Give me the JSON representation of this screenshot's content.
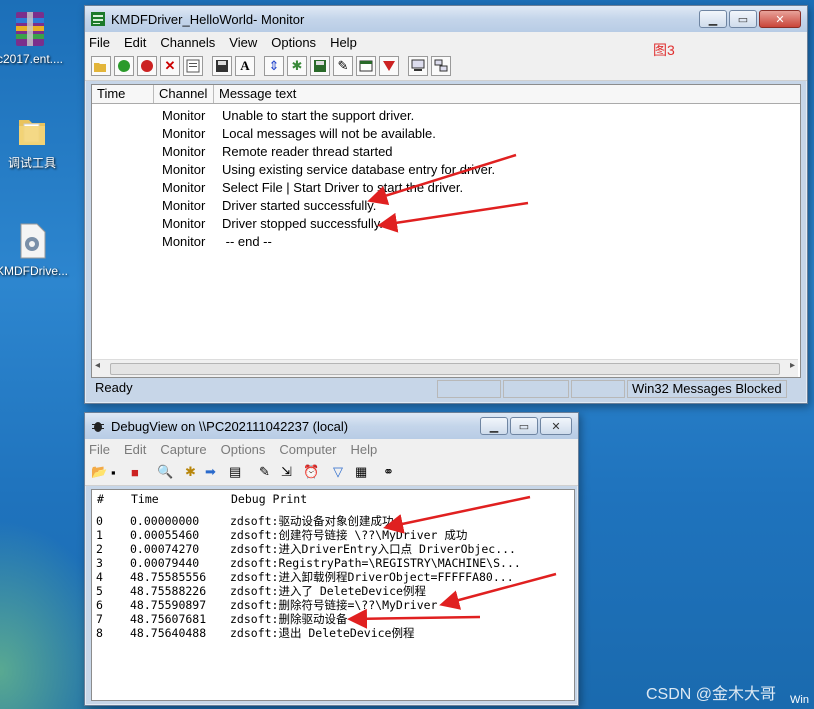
{
  "desktop": {
    "icons": [
      {
        "label": "c2017.ent...."
      },
      {
        "label": "调试工具"
      },
      {
        "label": "KMDFDrive..."
      }
    ],
    "watermark": "CSDN @金木大哥",
    "corner_text": "Win"
  },
  "monitor": {
    "title": "KMDFDriver_HelloWorld- Monitor",
    "menu": [
      "File",
      "Edit",
      "Channels",
      "View",
      "Options",
      "Help"
    ],
    "annotation": "图3",
    "columns": [
      "Time",
      "Channel",
      "Message text"
    ],
    "rows": [
      {
        "time": "",
        "channel": "Monitor",
        "message": "Unable to start the support driver."
      },
      {
        "time": "",
        "channel": "Monitor",
        "message": "Local messages will not be available."
      },
      {
        "time": "",
        "channel": "Monitor",
        "message": "Remote reader thread started"
      },
      {
        "time": "",
        "channel": "Monitor",
        "message": "Using existing service database entry for driver."
      },
      {
        "time": "",
        "channel": "Monitor",
        "message": "Select File | Start Driver to start the driver."
      },
      {
        "time": "",
        "channel": "Monitor",
        "message": "Driver started successfully."
      },
      {
        "time": "",
        "channel": "Monitor",
        "message": "Driver stopped successfully."
      },
      {
        "time": "",
        "channel": "Monitor",
        "message": " -- end --"
      }
    ],
    "status": {
      "ready": "Ready",
      "blocked": "Win32 Messages Blocked"
    }
  },
  "debugview": {
    "title": "DebugView on \\\\PC202111042237 (local)",
    "menu": [
      "File",
      "Edit",
      "Capture",
      "Options",
      "Computer",
      "Help"
    ],
    "columns": [
      "#",
      "Time",
      "Debug Print"
    ],
    "rows": [
      {
        "n": "0",
        "time": "0.00000000",
        "text": "zdsoft:驱动设备对象创建成功"
      },
      {
        "n": "1",
        "time": "0.00055460",
        "text": "zdsoft:创建符号链接 \\??\\MyDriver 成功"
      },
      {
        "n": "2",
        "time": "0.00074270",
        "text": "zdsoft:进入DriverEntry入口点 DriverObjec..."
      },
      {
        "n": "3",
        "time": "0.00079440",
        "text": "zdsoft:RegistryPath=\\REGISTRY\\MACHINE\\S..."
      },
      {
        "n": "4",
        "time": "48.75585556",
        "text": "zdsoft:进入卸载例程DriverObject=FFFFFA80..."
      },
      {
        "n": "5",
        "time": "48.75588226",
        "text": "zdsoft:进入了 DeleteDevice例程"
      },
      {
        "n": "6",
        "time": "48.75590897",
        "text": "zdsoft:删除符号链接=\\??\\MyDriver"
      },
      {
        "n": "7",
        "time": "48.75607681",
        "text": "zdsoft:删除驱动设备"
      },
      {
        "n": "8",
        "time": "48.75640488",
        "text": "zdsoft:退出 DeleteDevice例程"
      }
    ]
  },
  "colors": {
    "annotation_red": "#e02020",
    "accent_blue": "#1f73bd"
  }
}
